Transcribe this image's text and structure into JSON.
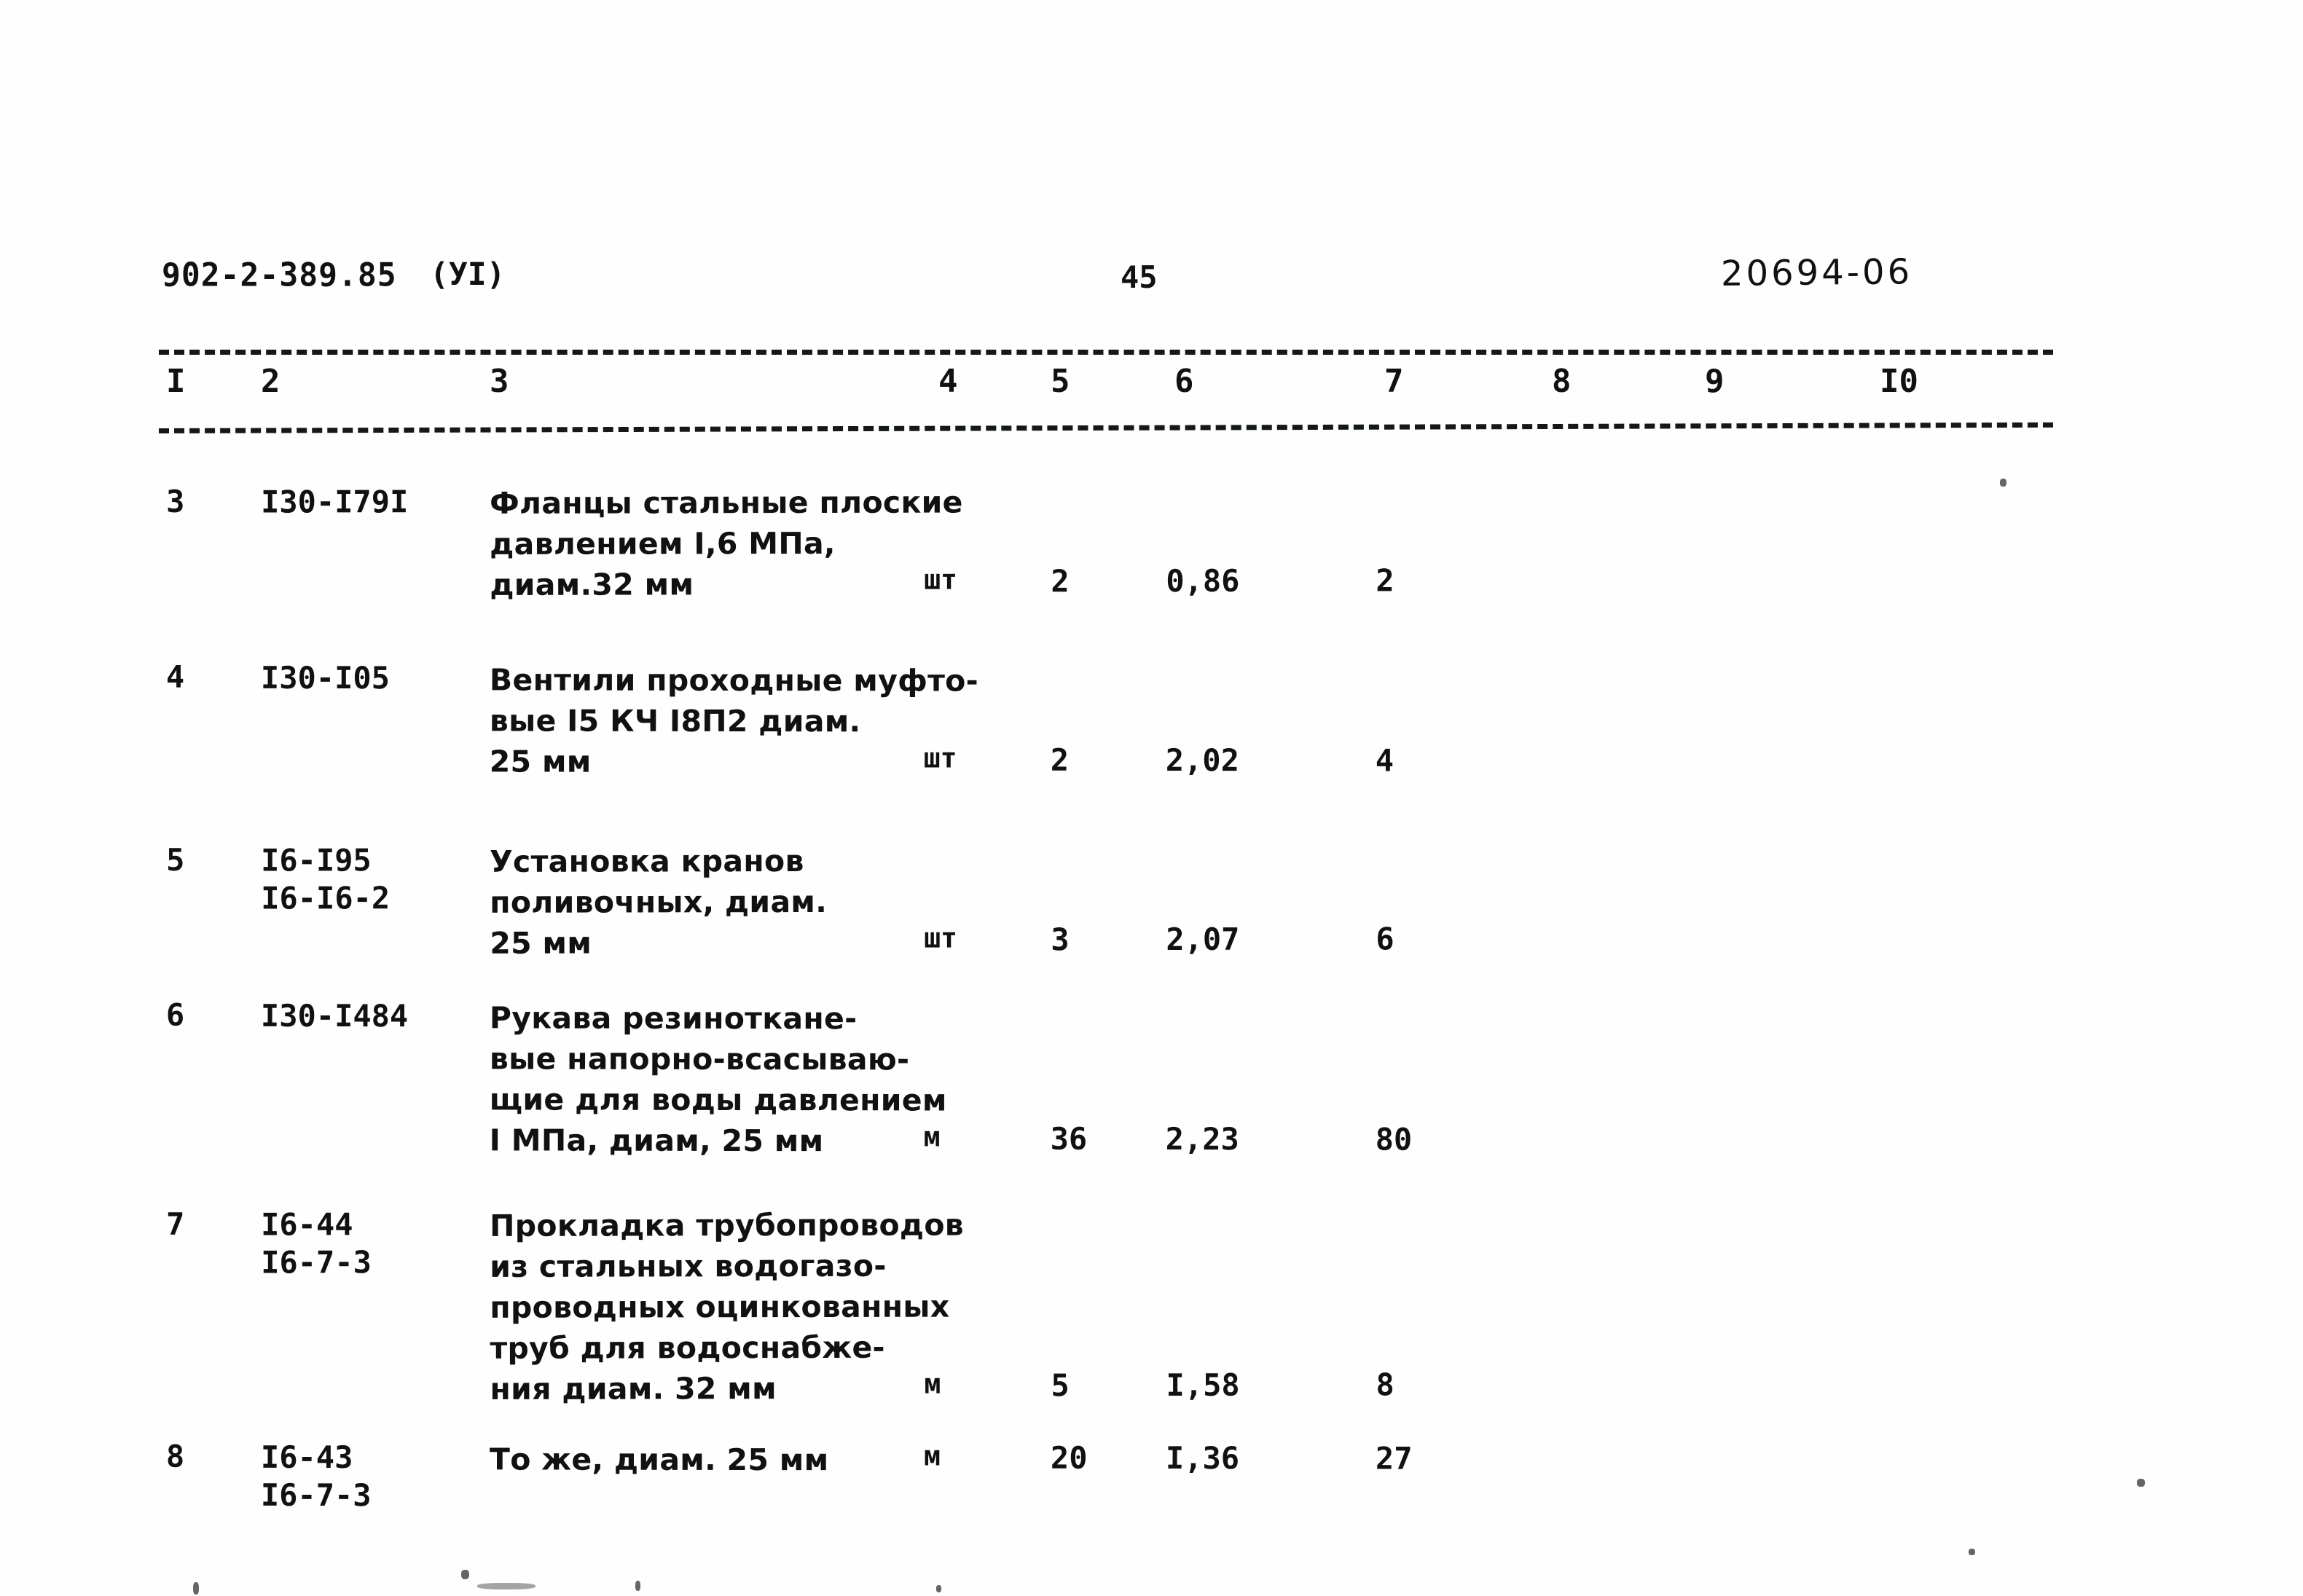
{
  "header": {
    "doc_code": "902-2-389.85",
    "volume": "(УI)",
    "page_number": "45",
    "archive_stamp": "20694-06"
  },
  "table": {
    "column_numbers": [
      "I",
      "2",
      "3",
      "4",
      "5",
      "6",
      "7",
      "8",
      "9",
      "I0"
    ],
    "rows": [
      {
        "pos": "3",
        "codes": [
          "I30-I79I"
        ],
        "description": [
          "Фланцы стальные плоские",
          "давлением I,6 МПа,",
          "диам.32 мм"
        ],
        "unit": "шт",
        "quantity": "2",
        "price": "0,86",
        "total": "2"
      },
      {
        "pos": "4",
        "codes": [
          "I30-I05"
        ],
        "description": [
          "Вентили проходные муфто-",
          "вые I5 КЧ I8П2 диам.",
          "25 мм"
        ],
        "unit": "шт",
        "quantity": "2",
        "price": "2,02",
        "total": "4"
      },
      {
        "pos": "5",
        "codes": [
          "I6-I95",
          "I6-I6-2"
        ],
        "description": [
          "Установка кранов",
          "поливочных, диам.",
          "25 мм"
        ],
        "unit": "шт",
        "quantity": "3",
        "price": "2,07",
        "total": "6"
      },
      {
        "pos": "6",
        "codes": [
          "I30-I484"
        ],
        "description": [
          "Рукава резиноткане-",
          "вые напорно-всасываю-",
          "щие для воды давлением",
          "I МПа, диам, 25 мм"
        ],
        "unit": "м",
        "quantity": "36",
        "price": "2,23",
        "total": "80"
      },
      {
        "pos": "7",
        "codes": [
          "I6-44",
          "I6-7-3"
        ],
        "description": [
          "Прокладка трубопроводов",
          "из стальных водогазо-",
          "проводных оцинкованных",
          "труб для водоснабже-",
          "ния диам. 32 мм"
        ],
        "unit": "м",
        "quantity": "5",
        "price": "I,58",
        "total": "8"
      },
      {
        "pos": "8",
        "codes": [
          "I6-43",
          "I6-7-3"
        ],
        "description": [
          "То же, диам. 25 мм"
        ],
        "unit": "м",
        "quantity": "20",
        "price": "I,36",
        "total": "27"
      }
    ]
  }
}
